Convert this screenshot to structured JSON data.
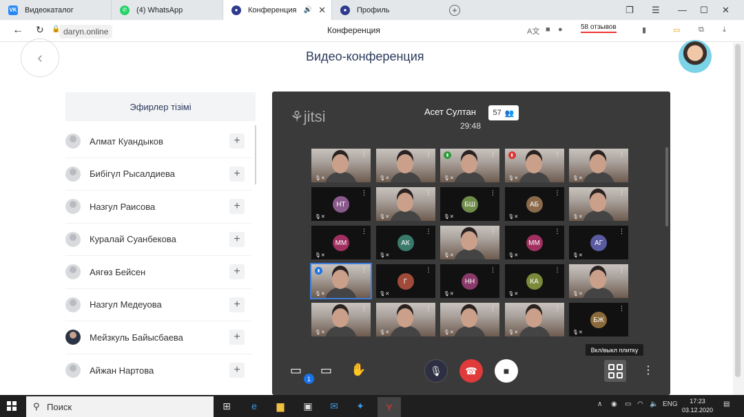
{
  "browser": {
    "tabs": [
      {
        "label": "Видеокаталог",
        "icon": "vk-icon"
      },
      {
        "label": "(4) WhatsApp",
        "icon": "whatsapp-icon"
      },
      {
        "label": "Конференция",
        "icon": "conference-icon"
      },
      {
        "label": "Профиль",
        "icon": "profile-icon"
      }
    ],
    "domain": "daryn.online",
    "page_title": "Конференция",
    "reviews": "58 отзывов"
  },
  "page": {
    "title": "Видео-конференция",
    "sidebar_header": "Эфирлер тізімі",
    "participants": [
      "Алмат Куандыков",
      "Бибігүл Рысалдиева",
      "Назгул Раисова",
      "Куралай Суанбекова",
      "Аягөз Бейсен",
      "Назгул Медеуова",
      "Мейзкуль Байысбаева",
      "Айжан Нартова"
    ]
  },
  "jitsi": {
    "logo": "jitsi",
    "speaker": "Асет Султан",
    "timer": "29:48",
    "participant_count": "57",
    "tooltip": "Вкл/выкл плитку",
    "chat_badge": "1",
    "tiles": [
      [
        "",
        "",
        "",
        "",
        ""
      ],
      [
        "НТ",
        "",
        "БШ",
        "АБ",
        ""
      ],
      [
        "ММ",
        "АК",
        "",
        "ММ",
        "АГ"
      ],
      [
        "",
        "Г",
        "НН",
        "КА",
        ""
      ],
      [
        "",
        "",
        "",
        "",
        "БЖ"
      ]
    ]
  },
  "taskbar": {
    "search_placeholder": "Поиск",
    "lang": "ENG",
    "time": "17:23",
    "date": "03.12.2020"
  },
  "colors": {
    "accent": "#2b3a5c",
    "hangup": "#e03a3a",
    "jitsi_bg": "#3a3a3a"
  }
}
